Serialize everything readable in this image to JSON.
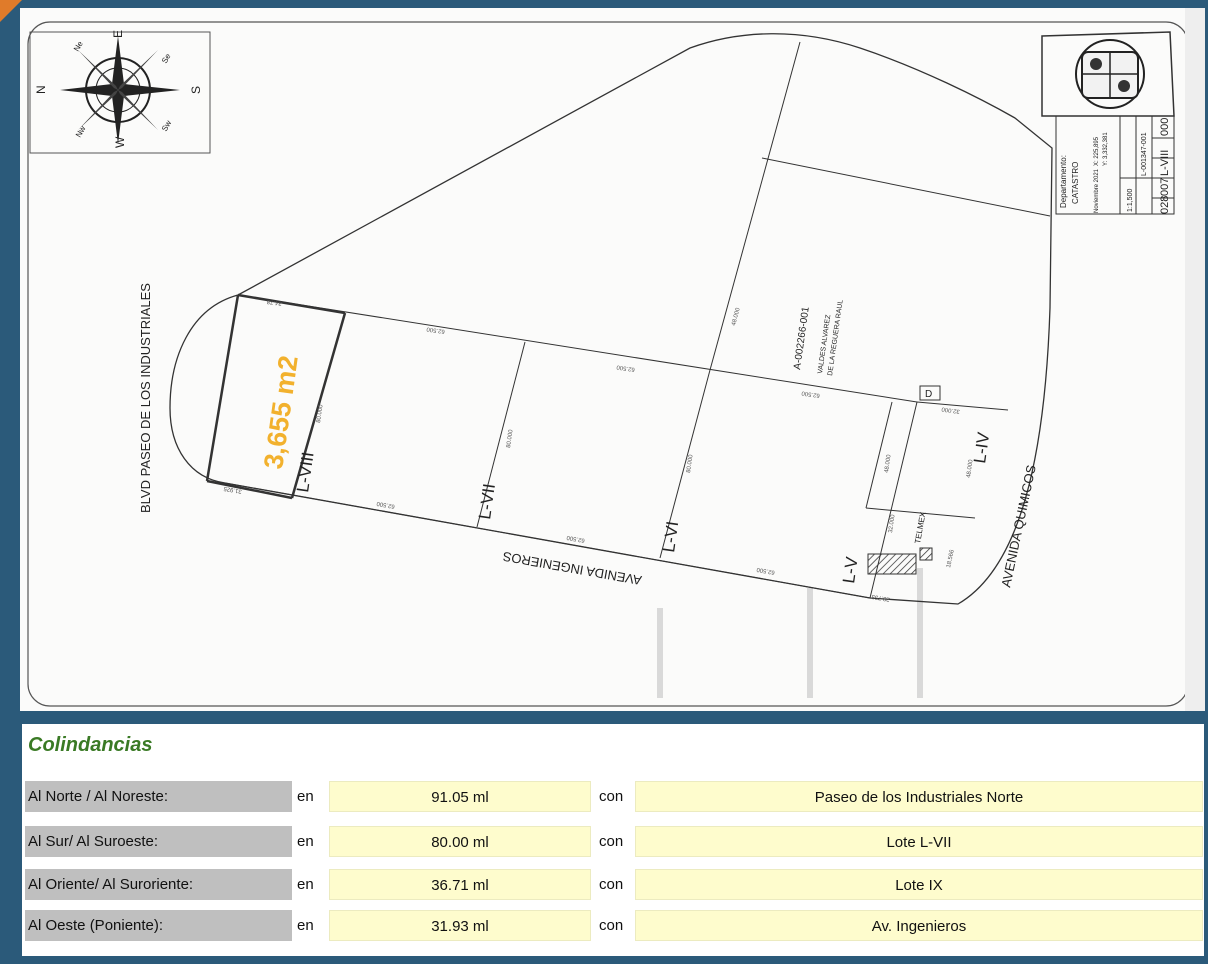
{
  "map": {
    "area_label": "3,655 m2",
    "streets": {
      "blvd": "BLVD PASEO DE LOS INDUSTRIALES",
      "ingenieros": "AVENIDA INGENIEROS",
      "quimicos": "AVENIDA QUIMICOS"
    },
    "lots": {
      "l8": "L-VIII",
      "l7": "L-VII",
      "l6": "L-VI",
      "l5": "L-V",
      "l4": "L-IV"
    },
    "parcel_id": "A-002266-001",
    "owner_line1": "VALDES ALVAREZ",
    "owner_line2": "DE LA REGUERA RAUL",
    "telmex": "TELMEX",
    "d_box": "D",
    "dims": {
      "l8_top": "34.78",
      "l8_side": "80.000",
      "l8_bottom": "31.925",
      "l7_top": "62.500",
      "l7_bottom": "62.500",
      "l7_side": "80.000",
      "l6_side": "80.000",
      "l6_top": "62.500",
      "l6_bottom": "62.500",
      "l5_top": "62.500",
      "l5_bottom": "62.500",
      "l4_top": "32.000",
      "l4_side1": "48.000",
      "l4_side2": "48.000",
      "upper": "48.000",
      "small1": "32.000",
      "small2": "28.753",
      "small3": "18.566"
    },
    "compass": {
      "n": "N",
      "s": "S",
      "e": "E",
      "w": "W",
      "ne": "Ne",
      "se": "Se",
      "nw": "Nw",
      "sw": "Sw"
    },
    "title_block": {
      "department_label": "Departamento:",
      "department": "CATASTRO",
      "date": "Noviembre 2021",
      "scale": "1:1,500",
      "coord_x": "X: 225,895",
      "coord_y": "Y: 3,332,381",
      "clave": "L-001347-001",
      "code_1": "028",
      "code_2": "007",
      "code_3": "L-VIII",
      "code_4": "000"
    }
  },
  "colindancias": {
    "title": "Colindancias",
    "rows": [
      {
        "direction": "Al Norte / Al Noreste:",
        "en": "en",
        "value": "91.05 ml",
        "con": "con",
        "with": "Paseo de los Industriales Norte"
      },
      {
        "direction": "Al Sur/ Al Suroeste:",
        "en": "en",
        "value": "80.00 ml",
        "con": "con",
        "with": "Lote L-VII"
      },
      {
        "direction": "Al Oriente/ Al Suroriente:",
        "en": "en",
        "value": "36.71 ml",
        "con": "con",
        "with": "Lote IX"
      },
      {
        "direction": "Al Oeste (Poniente):",
        "en": "en",
        "value": "31.93 ml",
        "con": "con",
        "with": "Av. Ingenieros"
      }
    ]
  },
  "colors": {
    "frame": "#2b5a7a",
    "accent_orange": "#e07b2a",
    "area_label": "#f2b12d",
    "title_green": "#3a7a25",
    "value_cell": "#fefccd",
    "label_cell": "#bfbfbf"
  }
}
